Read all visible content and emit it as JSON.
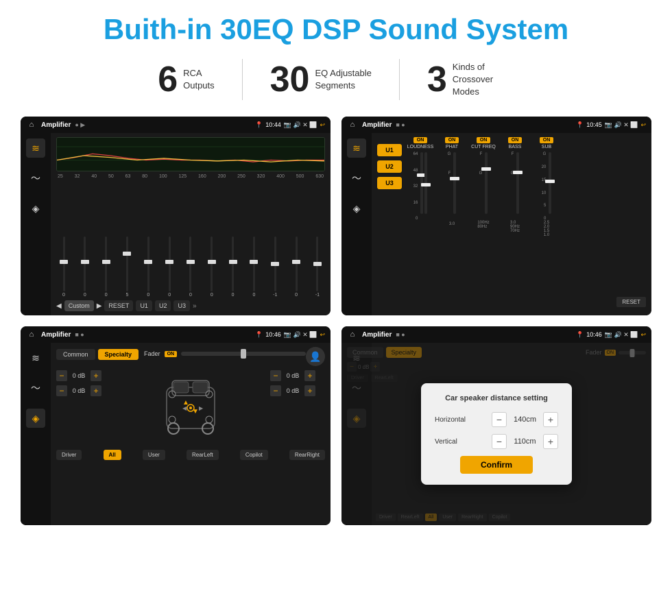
{
  "header": {
    "title": "Buith-in 30EQ DSP Sound System"
  },
  "stats": [
    {
      "number": "6",
      "desc_line1": "RCA",
      "desc_line2": "Outputs"
    },
    {
      "number": "30",
      "desc_line1": "EQ Adjustable",
      "desc_line2": "Segments"
    },
    {
      "number": "3",
      "desc_line1": "Kinds of",
      "desc_line2": "Crossover Modes"
    }
  ],
  "screens": {
    "screen1": {
      "app_name": "Amplifier",
      "time": "10:44",
      "eq_freqs": [
        "25",
        "32",
        "40",
        "50",
        "63",
        "80",
        "100",
        "125",
        "160",
        "200",
        "250",
        "320",
        "400",
        "500",
        "630"
      ],
      "eq_values": [
        "0",
        "0",
        "0",
        "5",
        "0",
        "0",
        "0",
        "0",
        "0",
        "0",
        "-1",
        "0",
        "-1"
      ],
      "buttons": [
        "Custom",
        "RESET",
        "U1",
        "U2",
        "U3"
      ]
    },
    "screen2": {
      "app_name": "Amplifier",
      "time": "10:45",
      "u_buttons": [
        "U1",
        "U2",
        "U3"
      ],
      "sections": [
        "LOUDNESS",
        "PHAT",
        "CUT FREQ",
        "BASS",
        "SUB"
      ],
      "reset_label": "RESET"
    },
    "screen3": {
      "app_name": "Amplifier",
      "time": "10:46",
      "tabs": [
        "Common",
        "Specialty"
      ],
      "fader_label": "Fader",
      "on_label": "ON",
      "db_values": [
        "0 dB",
        "0 dB",
        "0 dB",
        "0 dB"
      ],
      "bottom_buttons": [
        "Driver",
        "All",
        "User",
        "RearLeft",
        "RearRight",
        "Copilot"
      ]
    },
    "screen4": {
      "app_name": "Amplifier",
      "time": "10:46",
      "tabs": [
        "Common",
        "Specialty"
      ],
      "on_label": "ON",
      "dialog": {
        "title": "Car speaker distance setting",
        "horizontal_label": "Horizontal",
        "horizontal_value": "140cm",
        "vertical_label": "Vertical",
        "vertical_value": "110cm",
        "confirm_label": "Confirm",
        "minus_label": "−",
        "plus_label": "+"
      },
      "bottom_buttons": [
        "Driver",
        "All",
        "User",
        "RearLeft",
        "RearRight",
        "Copilot"
      ],
      "db_values": [
        "0 dB",
        "0 dB"
      ]
    }
  },
  "icons": {
    "home": "⌂",
    "back": "↩",
    "location": "📍",
    "camera": "📷",
    "volume": "🔊",
    "eq_icon": "≋",
    "wave_icon": "〜",
    "speaker_icon": "◈"
  }
}
